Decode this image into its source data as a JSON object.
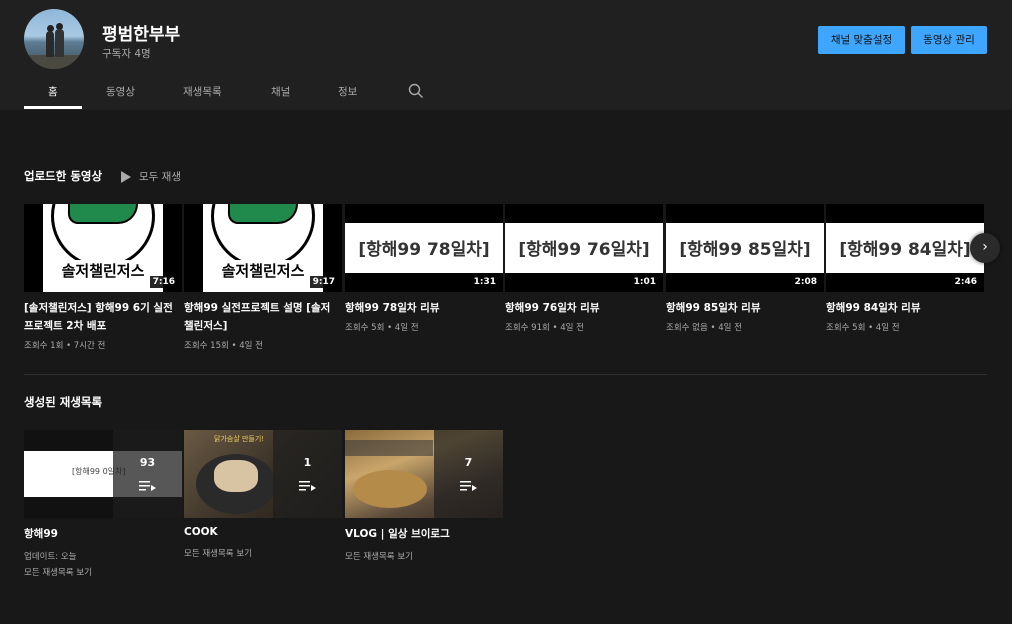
{
  "channel": {
    "name": "평범한부부",
    "subscribers": "구독자 4명",
    "customize_label": "채널 맞춤설정",
    "manage_label": "동영상 관리"
  },
  "tabs": [
    "홈",
    "동영상",
    "재생목록",
    "채널",
    "정보"
  ],
  "uploads": {
    "title": "업로드한 동영상",
    "play_all": "모두 재생",
    "videos": [
      {
        "title": "[솔저챌린저스] 항해99 6기 실전 프로젝트 2차 배포",
        "meta": "조회수 1회 • 7시간 전",
        "duration": "7:16",
        "thumb_text": "솔저챌린저스"
      },
      {
        "title": "항해99 실전프로젝트 설명 [솔저챌린저스]",
        "meta": "조회수 15회 • 4일 전",
        "duration": "9:17",
        "thumb_text": "솔저챌린저스"
      },
      {
        "title": "항해99 78일차 리뷰",
        "meta": "조회수 5회 • 4일 전",
        "duration": "1:31",
        "thumb_text": "[항해99 78일차]"
      },
      {
        "title": "항해99 76일차 리뷰",
        "meta": "조회수 91회 • 4일 전",
        "duration": "1:01",
        "thumb_text": "[항해99 76일차]"
      },
      {
        "title": "항해99 85일차 리뷰",
        "meta": "조회수 없음 • 4일 전",
        "duration": "2:08",
        "thumb_text": "[항해99 85일차]"
      },
      {
        "title": "항해99 84일차 리뷰",
        "meta": "조회수 5회 • 4일 전",
        "duration": "2:46",
        "thumb_text": "[항해99 84일차]"
      }
    ]
  },
  "playlists": {
    "title": "생성된 재생목록",
    "items": [
      {
        "title": "항해99",
        "count": "93",
        "meta1": "업데이트: 오늘",
        "meta2": "모든 재생목록 보기",
        "thumb_text": "[항해99 0일차]"
      },
      {
        "title": "COOK",
        "count": "1",
        "meta1": "모든 재생목록 보기",
        "meta2": "",
        "thumb_text": "닭가슴살 만들기!"
      },
      {
        "title": "VLOG | 일상 브이로그",
        "count": "7",
        "meta1": "모든 재생목록 보기",
        "meta2": ""
      }
    ]
  },
  "icons": {
    "search": "search-icon",
    "next": "chevron-right-icon",
    "play": "play-icon",
    "queue": "playlist-queue-icon"
  },
  "colors": {
    "accent": "#3ea6ff",
    "background": "#181818",
    "header": "#202020"
  }
}
